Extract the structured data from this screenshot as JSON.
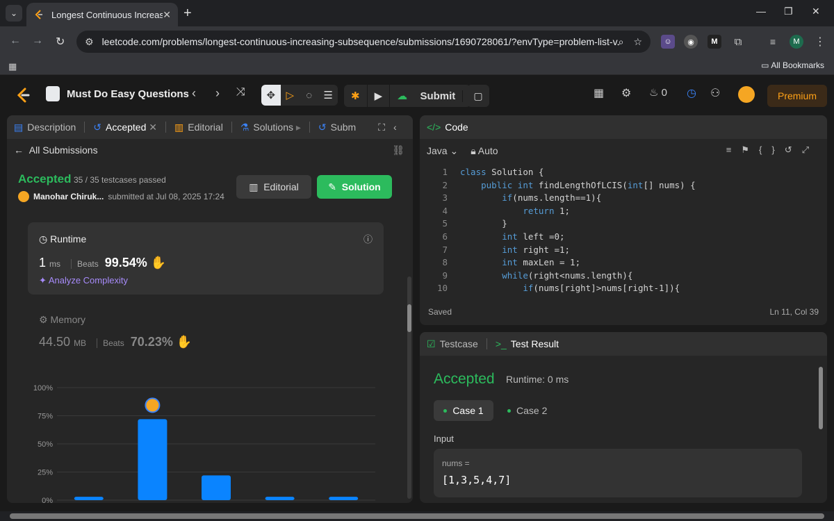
{
  "browser": {
    "tab_title": "Longest Continuous Increasing",
    "url": "leetcode.com/problems/longest-continuous-increasing-subsequence/submissions/1690728061/?envType=problem-list-v...",
    "bookmarks_label": "All Bookmarks",
    "profile_initial": "M"
  },
  "header": {
    "list_name": "Must Do Easy Questions",
    "submit_label": "Submit",
    "streak": "0",
    "premium_label": "Premium"
  },
  "left_panel": {
    "tabs": [
      "Description",
      "Accepted",
      "Editorial",
      "Solutions",
      "Subm"
    ],
    "back_label": "All Submissions",
    "status": "Accepted",
    "testcases": "35 / 35 testcases passed",
    "author": "Manohar Chiruk...",
    "submitted": "submitted at Jul 08, 2025 17:24",
    "editorial_btn": "Editorial",
    "solution_btn": "Solution",
    "runtime": {
      "title": "Runtime",
      "value": "1",
      "unit": "ms",
      "beats_label": "Beats",
      "beats_pct": "99.54%",
      "analyze": "Analyze Complexity"
    },
    "memory": {
      "title": "Memory",
      "value": "44.50",
      "unit": "MB",
      "beats_label": "Beats",
      "beats_pct": "70.23%"
    }
  },
  "chart_data": {
    "type": "bar",
    "categories": [
      "",
      "",
      "",
      "",
      ""
    ],
    "values": [
      3,
      72,
      22,
      3,
      3
    ],
    "ytick_labels": [
      "100%",
      "75%",
      "50%",
      "25%",
      "0%"
    ],
    "ylim": [
      0,
      100
    ],
    "highlight_index": 1,
    "bar_color": "#0a84ff"
  },
  "code_panel": {
    "title": "Code",
    "language": "Java",
    "mode": "Auto",
    "lines": [
      "class Solution {",
      "    public int findLengthOfLCIS(int[] nums) {",
      "        if(nums.length==1){",
      "            return 1;",
      "        }",
      "        int left =0;",
      "        int right =1;",
      "        int maxLen = 1;",
      "        while(right<nums.length){",
      "            if(nums[right]>nums[right-1]){"
    ],
    "status": "Saved",
    "cursor": "Ln 11, Col 39"
  },
  "test_panel": {
    "tab_testcase": "Testcase",
    "tab_result": "Test Result",
    "status": "Accepted",
    "runtime": "Runtime: 0 ms",
    "case1": "Case 1",
    "case2": "Case 2",
    "input_label": "Input",
    "var_name": "nums =",
    "var_value": "[1,3,5,4,7]"
  },
  "colors": {
    "accent_green": "#2cbb5d",
    "premium": "#ffa116",
    "bar": "#0a84ff"
  }
}
